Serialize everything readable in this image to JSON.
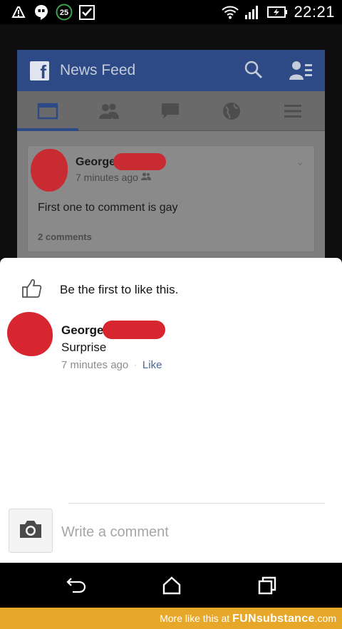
{
  "status_bar": {
    "icons_left": [
      "alert-icon",
      "hangouts-icon",
      "notification-count-badge",
      "checkbox-icon"
    ],
    "notification_count": "25",
    "icons_right": [
      "wifi-icon",
      "signal-icon",
      "battery-charging-icon"
    ],
    "time": "22:21"
  },
  "background_app": {
    "header": {
      "title": "News Feed",
      "icons": [
        "facebook-logo-icon",
        "search-icon",
        "friend-requests-icon"
      ]
    },
    "tabs": [
      "news-feed-tab-icon",
      "friends-tab-icon",
      "messages-tab-icon",
      "notifications-globe-icon",
      "menu-icon"
    ],
    "active_tab": "news-feed-tab-icon",
    "post": {
      "author": "George",
      "time": "7 minutes ago",
      "audience_icon": "friends-icon",
      "text": "First one to comment is gay",
      "comments_count": "2 comments"
    }
  },
  "comment_sheet": {
    "like_prompt": "Be the first to like this.",
    "comment": {
      "author": "George",
      "text": "Surprise",
      "time": "7 minutes ago",
      "separator": "·",
      "like_label": "Like"
    },
    "composer": {
      "placeholder": "Write a comment",
      "camera_icon": "camera-icon"
    }
  },
  "nav_bar": {
    "buttons": [
      "back-icon",
      "home-icon",
      "recents-icon"
    ]
  },
  "watermark": {
    "prefix": "More like this at ",
    "brand": "FUNsubstance",
    "suffix": ".com"
  },
  "colors": {
    "facebook_blue": "#2e4a86",
    "link_blue": "#4a66a0",
    "redaction_red": "#d7262f",
    "watermark_orange": "#e7a82a"
  }
}
